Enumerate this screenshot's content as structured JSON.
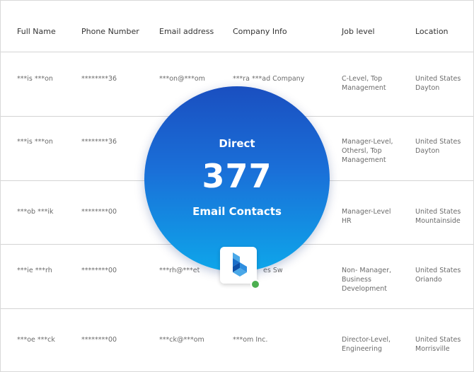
{
  "table": {
    "headers": [
      "Full Name",
      "Phone Number",
      "Email address",
      "Company Info",
      "Job level",
      "Location"
    ],
    "rows": [
      [
        "***is ***on",
        "********36",
        "***on@***om",
        "***ra ***ad Company",
        "C-Level, Top\nManagement",
        "United States\nDayton"
      ],
      [
        "***is ***on",
        "********36",
        "",
        "",
        "Manager-Level,\nOthersl, Top\nManagement",
        "United States\nDayton"
      ],
      [
        "***ob ***ik",
        "********00",
        "",
        "",
        "Manager-Level\nHR",
        "United States\nMountainside"
      ],
      [
        "***ie ***rh",
        "********00",
        "***rh@***et",
        "es Sw",
        "Non- Manager,\nBusiness\nDevelopment",
        "United States\nOriando"
      ],
      [
        "***oe ***ck",
        "********00",
        "***ck@***om",
        "***om Inc.",
        "Director-Level,\nEngineering",
        "United States\nMorrisville"
      ]
    ]
  },
  "overlay": {
    "line1": "Direct",
    "count": "377",
    "line2": "Email Contacts",
    "badge_icon": "company-logo-icon",
    "status_icon": "online-status-icon",
    "gradient_top": "#1a4fc0",
    "gradient_bottom": "#0ea6ea",
    "status_color": "#4caf50"
  }
}
